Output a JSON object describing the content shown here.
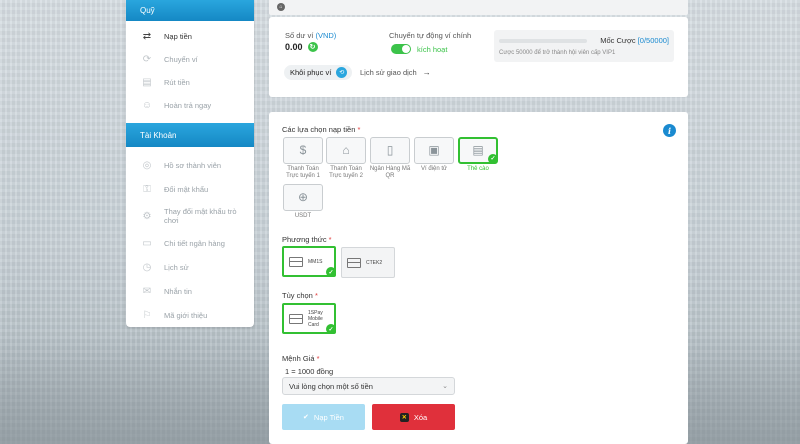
{
  "sidebar": {
    "section1_title": "Quỹ",
    "section1_items": [
      {
        "label": "Nạp tiền",
        "icon": "deposit-icon"
      },
      {
        "label": "Chuyển ví",
        "icon": "transfer-icon"
      },
      {
        "label": "Rút tiền",
        "icon": "withdraw-icon"
      },
      {
        "label": "Hoàn trả ngay",
        "icon": "refund-icon"
      }
    ],
    "section2_title": "Tài Khoản",
    "section2_items": [
      {
        "label": "Hồ sơ thành viên",
        "icon": "profile-icon"
      },
      {
        "label": "Đổi mật khẩu",
        "icon": "key-icon"
      },
      {
        "label": "Thay đổi mật khẩu trò chơi",
        "icon": "game-password-icon"
      },
      {
        "label": "Chi tiết ngân hàng",
        "icon": "bank-card-icon"
      },
      {
        "label": "Lịch sử",
        "icon": "history-icon"
      },
      {
        "label": "Nhắn tin",
        "icon": "mail-icon"
      },
      {
        "label": "Mã giới thiệu",
        "icon": "referral-icon"
      }
    ]
  },
  "wallet": {
    "balance_label": "Số dư ví",
    "balance_currency": "(VND)",
    "balance_value": "0.00",
    "auto_transfer_label": "Chuyển tự động ví chính",
    "auto_transfer_state": "kích hoạt",
    "restore_label": "Khôi phục ví",
    "history_label": "Lịch sử giao dịch",
    "vip_milestone_label": "Mốc Cược",
    "vip_milestone_count": "[0/50000]",
    "vip_note": "Cược 50000 để trở thành hội viên cấp VIP1"
  },
  "deposit": {
    "options_title": "Các lựa chọn nạp tiền",
    "options": [
      {
        "label": "Thanh Toán Trực tuyến 1",
        "icon": "coin-icon",
        "selected": false
      },
      {
        "label": "Thanh Toán Trực tuyến 2",
        "icon": "bank-icon",
        "selected": false
      },
      {
        "label": "Ngân Hàng Mã QR",
        "icon": "qr-phone-icon",
        "selected": false
      },
      {
        "label": "Ví điện tử",
        "icon": "e-wallet-icon",
        "selected": false
      },
      {
        "label": "Thẻ cào",
        "icon": "scratch-card-icon",
        "selected": true
      },
      {
        "label": "USDT",
        "icon": "usdt-icon",
        "selected": false
      }
    ],
    "method_title": "Phương thức",
    "methods": [
      {
        "label": "MM1S",
        "selected": true
      },
      {
        "label": "CTEK2",
        "selected": false
      }
    ],
    "choice_title": "Tùy chọn",
    "choices": [
      {
        "label_line1": "1SPay",
        "label_line2": "Mobile Card",
        "selected": true
      }
    ],
    "denom_title": "Mệnh Giá",
    "denom_rate": "1 = 1000 đồng",
    "denom_placeholder": "Vui lòng chọn một số tiền",
    "submit_label": "Nạp Tiền",
    "clear_label": "Xóa"
  },
  "colors": {
    "accent": "#1a8ad0",
    "selected": "#32c032",
    "danger": "#e0303b"
  }
}
